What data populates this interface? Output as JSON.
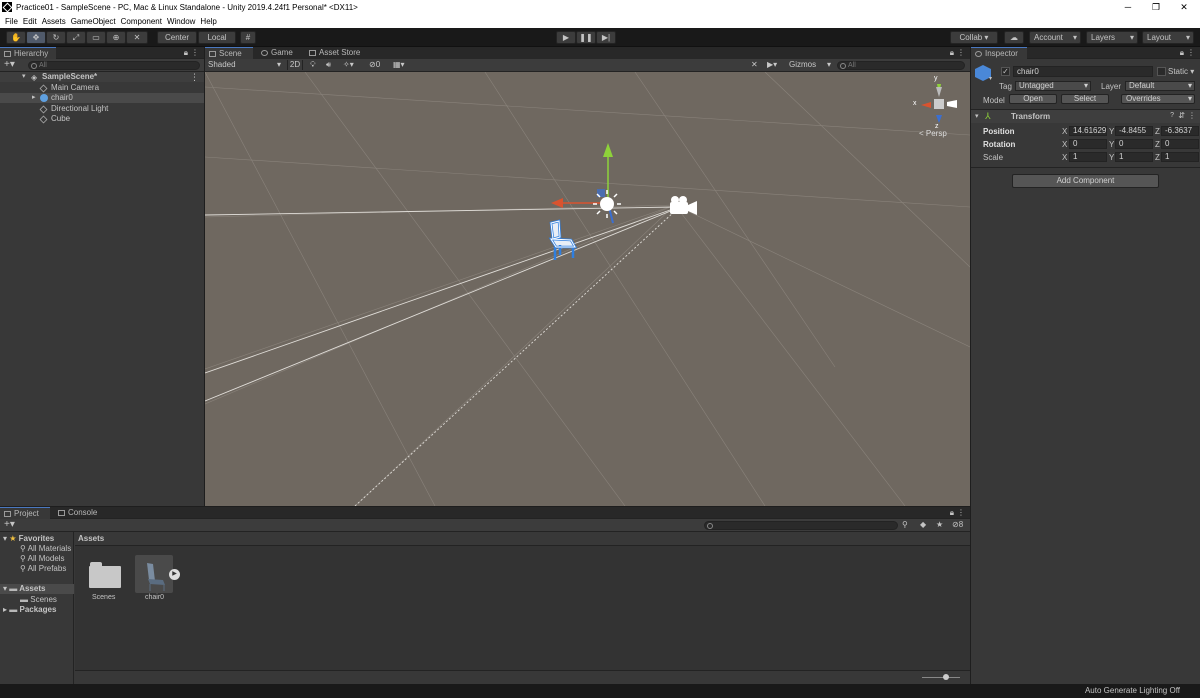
{
  "window": {
    "title": "Practice01 - SampleScene - PC, Mac & Linux Standalone - Unity 2019.4.24f1 Personal* <DX11>",
    "controls": [
      "─",
      "❐",
      "✕"
    ]
  },
  "menu": [
    "File",
    "Edit",
    "Assets",
    "GameObject",
    "Component",
    "Window",
    "Help"
  ],
  "toolbar": {
    "pivot": "Center",
    "space": "Local",
    "collab": "Collab ▾",
    "account": "Account",
    "layers": "Layers",
    "layout": "Layout"
  },
  "hierarchy": {
    "tab": "Hierarchy",
    "search_placeholder": "All",
    "scene": "SampleScene*",
    "items": [
      "Main Camera",
      "chair0",
      "Directional Light",
      "Cube"
    ]
  },
  "scene_view": {
    "tabs": [
      "Scene",
      "Game",
      "Asset Store"
    ],
    "shading": "Shaded",
    "mode_2d": "2D",
    "hidden_count": "0",
    "gizmos": "Gizmos",
    "search_placeholder": "All",
    "persp": "< Persp",
    "axis_x": "x",
    "axis_y": "y",
    "axis_z": "z"
  },
  "inspector": {
    "tab": "Inspector",
    "object_name": "chair0",
    "static_label": "Static",
    "tag_label": "Tag",
    "tag_value": "Untagged",
    "layer_label": "Layer",
    "layer_value": "Default",
    "model_label": "Model",
    "open": "Open",
    "select": "Select",
    "overrides": "Overrides",
    "transform_title": "Transform",
    "position_label": "Position",
    "rotation_label": "Rotation",
    "scale_label": "Scale",
    "position": {
      "x": "14.61629",
      "y": "-4.8455",
      "z": "-6.3637"
    },
    "rotation": {
      "x": "0",
      "y": "0",
      "z": "0"
    },
    "scale": {
      "x": "1",
      "y": "1",
      "z": "1"
    },
    "x": "X",
    "y": "Y",
    "z": "Z",
    "add_component": "Add Component"
  },
  "project": {
    "tabs": [
      "Project",
      "Console"
    ],
    "hidden_count": "8",
    "favorites_label": "Favorites",
    "favorites": [
      "All Materials",
      "All Models",
      "All Prefabs"
    ],
    "assets_label": "Assets",
    "asset_folders": [
      "Scenes"
    ],
    "packages_label": "Packages",
    "breadcrumb": "Assets",
    "items": [
      "Scenes",
      "chair0"
    ]
  },
  "statusbar": {
    "text": "Auto Generate Lighting Off"
  },
  "colors": {
    "accent": "#4a78c0",
    "scene_bg": "#6f6860",
    "panel": "#383838"
  }
}
